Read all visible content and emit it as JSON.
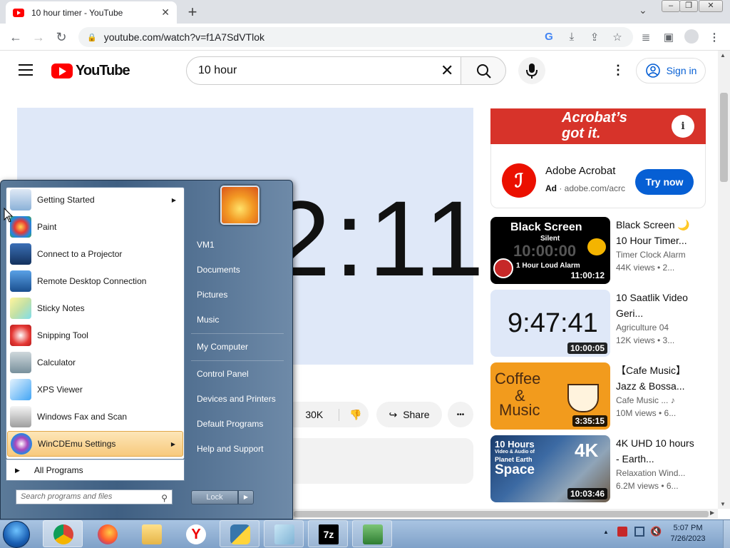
{
  "browser": {
    "tab_title": "10 hour timer - YouTube",
    "url": "youtube.com/watch?v=f1A7SdVTlok",
    "new_tab": "+",
    "tab_close": "✕"
  },
  "youtube": {
    "logo_text": "YouTube",
    "search_value": "10 hour",
    "sign_in": "Sign in",
    "timer_display": "2:11",
    "likes": "30K",
    "share": "Share",
    "more": "•••"
  },
  "ad": {
    "slogan_line1": "Acrobat’s",
    "slogan_line2": "got it.",
    "advertiser": "Adobe Acrobat",
    "ad_label": "Ad",
    "domain": "adobe.com/acrc",
    "cta": "Try now"
  },
  "recommendations": [
    {
      "title": "Black Screen 🌙 10 Hour Timer...",
      "channel": "Timer Clock Alarm",
      "views": "44K views  •  2...",
      "duration": "11:00:12",
      "thumb_line1": "Black Screen",
      "thumb_line2": "Silent",
      "thumb_line3": "10:00:00",
      "thumb_line4": "1 Hour Loud Alarm"
    },
    {
      "title": "10 Saatlik Video Geri...",
      "channel": "Agriculture 04",
      "views": "12K views  •  3...",
      "duration": "10:00:05",
      "thumb_line1": "9:47:41"
    },
    {
      "title": "【Cafe Music】 Jazz & Bossa...",
      "channel": "Cafe Music ...  ♪",
      "views": "10M views  •  6...",
      "duration": "3:35:15",
      "thumb_line1": "Coffee",
      "thumb_line2": "&",
      "thumb_line3": "Music"
    },
    {
      "title": "4K UHD 10 hours - Earth...",
      "channel": "Relaxation Wind...",
      "views": "6.2M views  •  6...",
      "duration": "10:03:46",
      "thumb_line1": "10 Hours",
      "thumb_line2": "Video & Audio of",
      "thumb_line3": "Planet Earth",
      "thumb_line4": "Space",
      "thumb_line5": "4K"
    }
  ],
  "start_menu": {
    "items": [
      {
        "label": "Getting Started",
        "has_arrow": true
      },
      {
        "label": "Paint"
      },
      {
        "label": "Connect to a Projector"
      },
      {
        "label": "Remote Desktop Connection"
      },
      {
        "label": "Sticky Notes"
      },
      {
        "label": "Snipping Tool"
      },
      {
        "label": "Calculator"
      },
      {
        "label": "XPS Viewer"
      },
      {
        "label": "Windows Fax and Scan"
      },
      {
        "label": "WinCDEmu Settings",
        "has_arrow": true,
        "highlighted": true
      }
    ],
    "all_programs": "All Programs",
    "search_placeholder": "Search programs and files",
    "right_items": [
      "VM1",
      "Documents",
      "Pictures",
      "Music",
      "My Computer",
      "Control Panel",
      "Devices and Printers",
      "Default Programs",
      "Help and Support"
    ],
    "lock": "Lock"
  },
  "taskbar": {
    "time": "5:07 PM",
    "date": "7/26/2023",
    "sevenzip_label": "7z"
  },
  "colors": {
    "youtube_red": "#ff0000",
    "link_blue": "#065fd4",
    "adobe_red": "#eb1000"
  }
}
